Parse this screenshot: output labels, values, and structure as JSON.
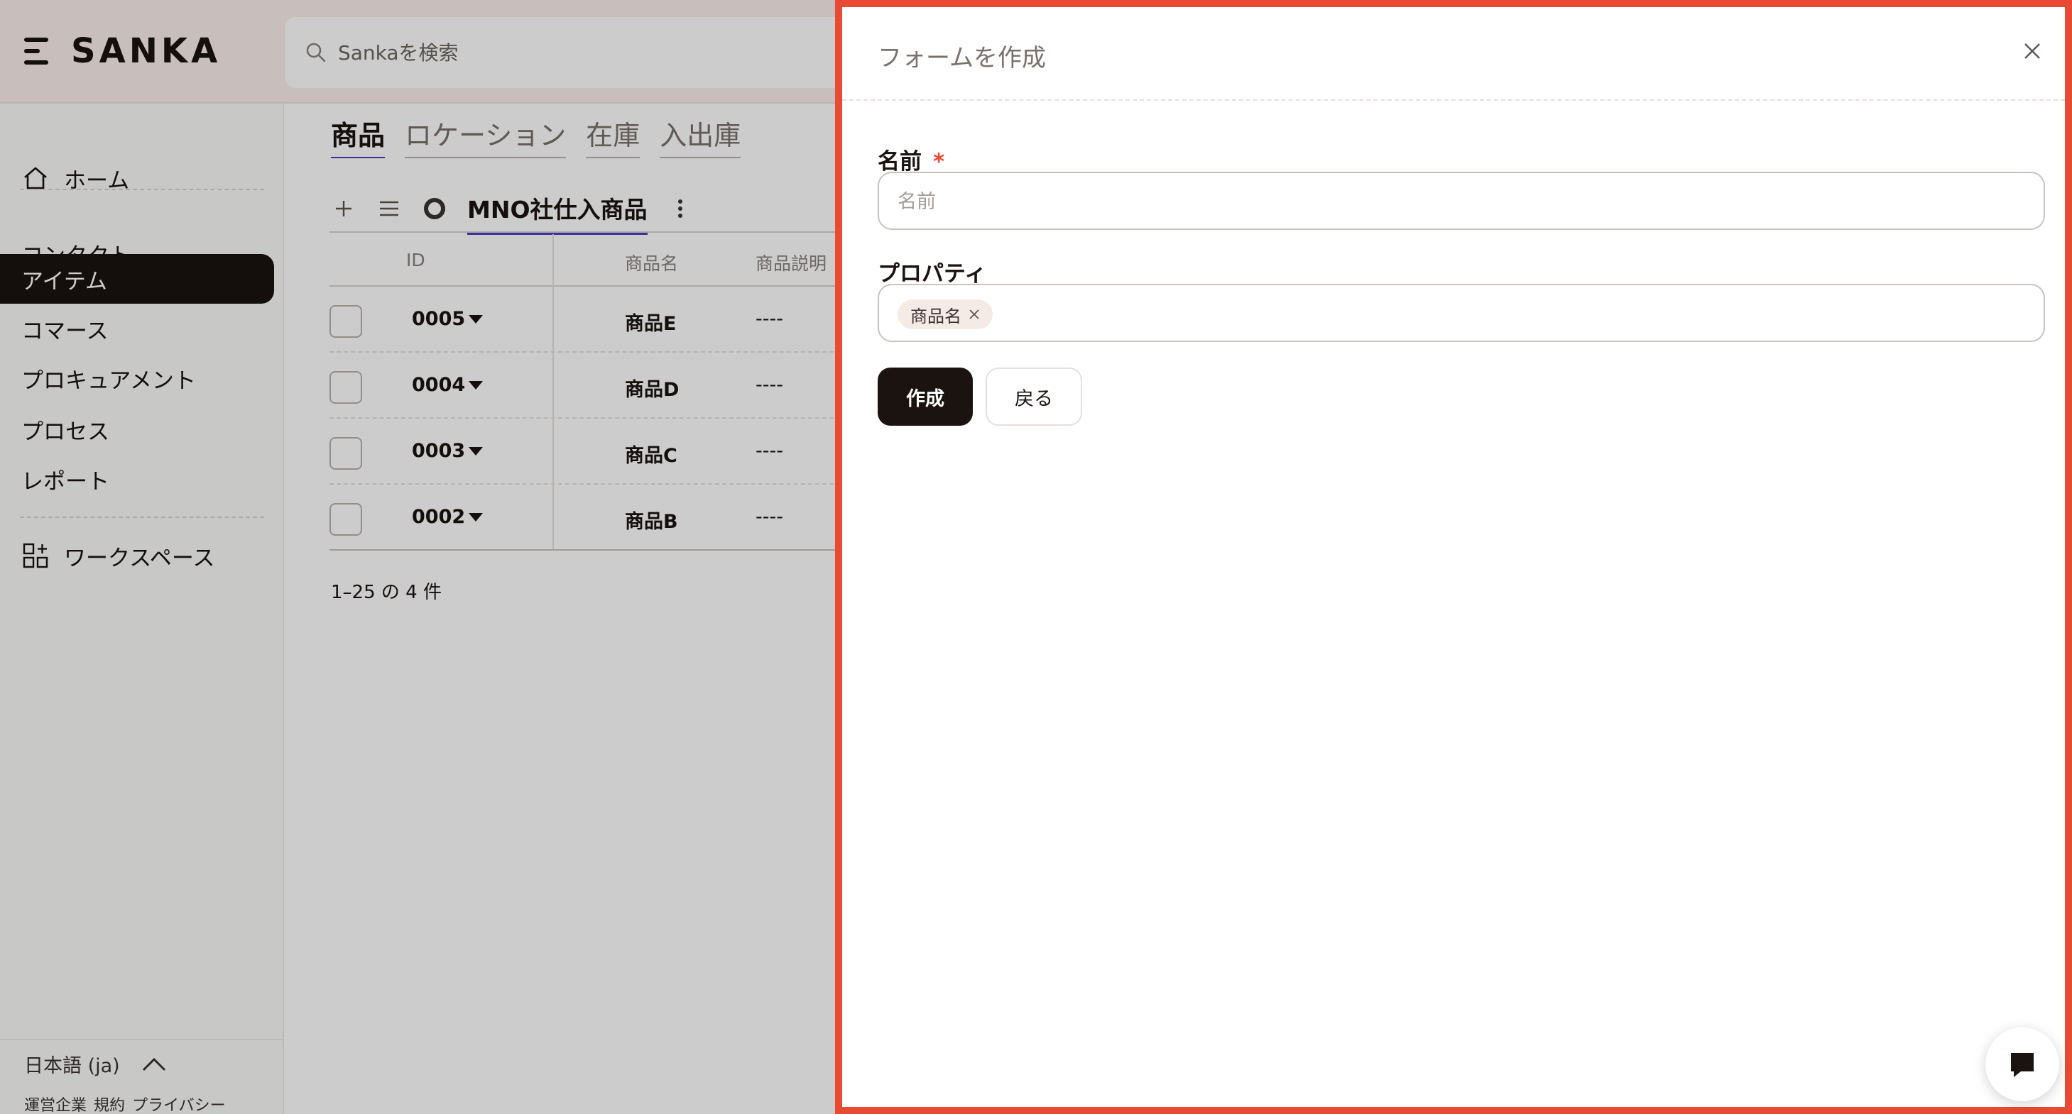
{
  "app": {
    "brand": "SANKA",
    "search_placeholder": "Sankaを検索"
  },
  "sidebar": {
    "home": "ホーム",
    "items": [
      {
        "label": "コンタクト"
      },
      {
        "label": "アイテム"
      },
      {
        "label": "コマース"
      },
      {
        "label": "プロキュアメント"
      },
      {
        "label": "プロセス"
      },
      {
        "label": "レポート"
      }
    ],
    "active_item": "アイテム",
    "workspace": "ワークスペース",
    "language": "日本語 (ja)",
    "footer_links": [
      "運営企業",
      "規約",
      "プライバシー"
    ]
  },
  "main": {
    "tabs": [
      {
        "label": "商品",
        "active": true
      },
      {
        "label": "ロケーション",
        "active": false
      },
      {
        "label": "在庫",
        "active": false
      },
      {
        "label": "入出庫",
        "active": false
      }
    ],
    "view_title": "MNO社仕入商品",
    "table": {
      "columns": [
        "ID",
        "商品名",
        "商品説明"
      ],
      "rows": [
        {
          "id": "0005",
          "name": "商品E",
          "desc": "----"
        },
        {
          "id": "0004",
          "name": "商品D",
          "desc": "----"
        },
        {
          "id": "0003",
          "name": "商品C",
          "desc": "----"
        },
        {
          "id": "0002",
          "name": "商品B",
          "desc": "----"
        }
      ]
    },
    "pagination": "1–25 の 4 件"
  },
  "drawer": {
    "title": "フォームを作成",
    "name_label": "名前",
    "required_mark": "*",
    "name_placeholder": "名前",
    "name_value": "",
    "property_label": "プロパティ",
    "property_chips": [
      "商品名"
    ],
    "submit_label": "作成",
    "back_label": "戻る"
  },
  "colors": {
    "accent_border": "#e84a33",
    "primary": "#1a1310",
    "tab_underline": "#4b3fbe",
    "topbar_bg": "#fbeeea"
  }
}
